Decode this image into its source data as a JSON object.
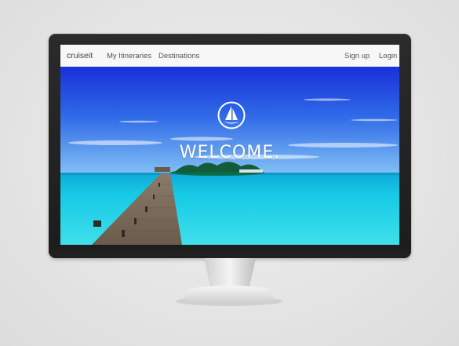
{
  "nav": {
    "brand": "cruiseit",
    "links": [
      {
        "label": "My Itineraries"
      },
      {
        "label": "Destinations"
      }
    ],
    "right_links": [
      {
        "label": "Sign up"
      },
      {
        "label": "Login"
      }
    ]
  },
  "hero": {
    "heading": "WELCOME."
  },
  "icons": {
    "logo": "sailboat-logo-icon"
  },
  "colors": {
    "sky_top": "#1b33d6",
    "sky_bottom": "#6fb6f5",
    "sea": "#12c6e0",
    "nav_bg": "#f7f7f7"
  }
}
